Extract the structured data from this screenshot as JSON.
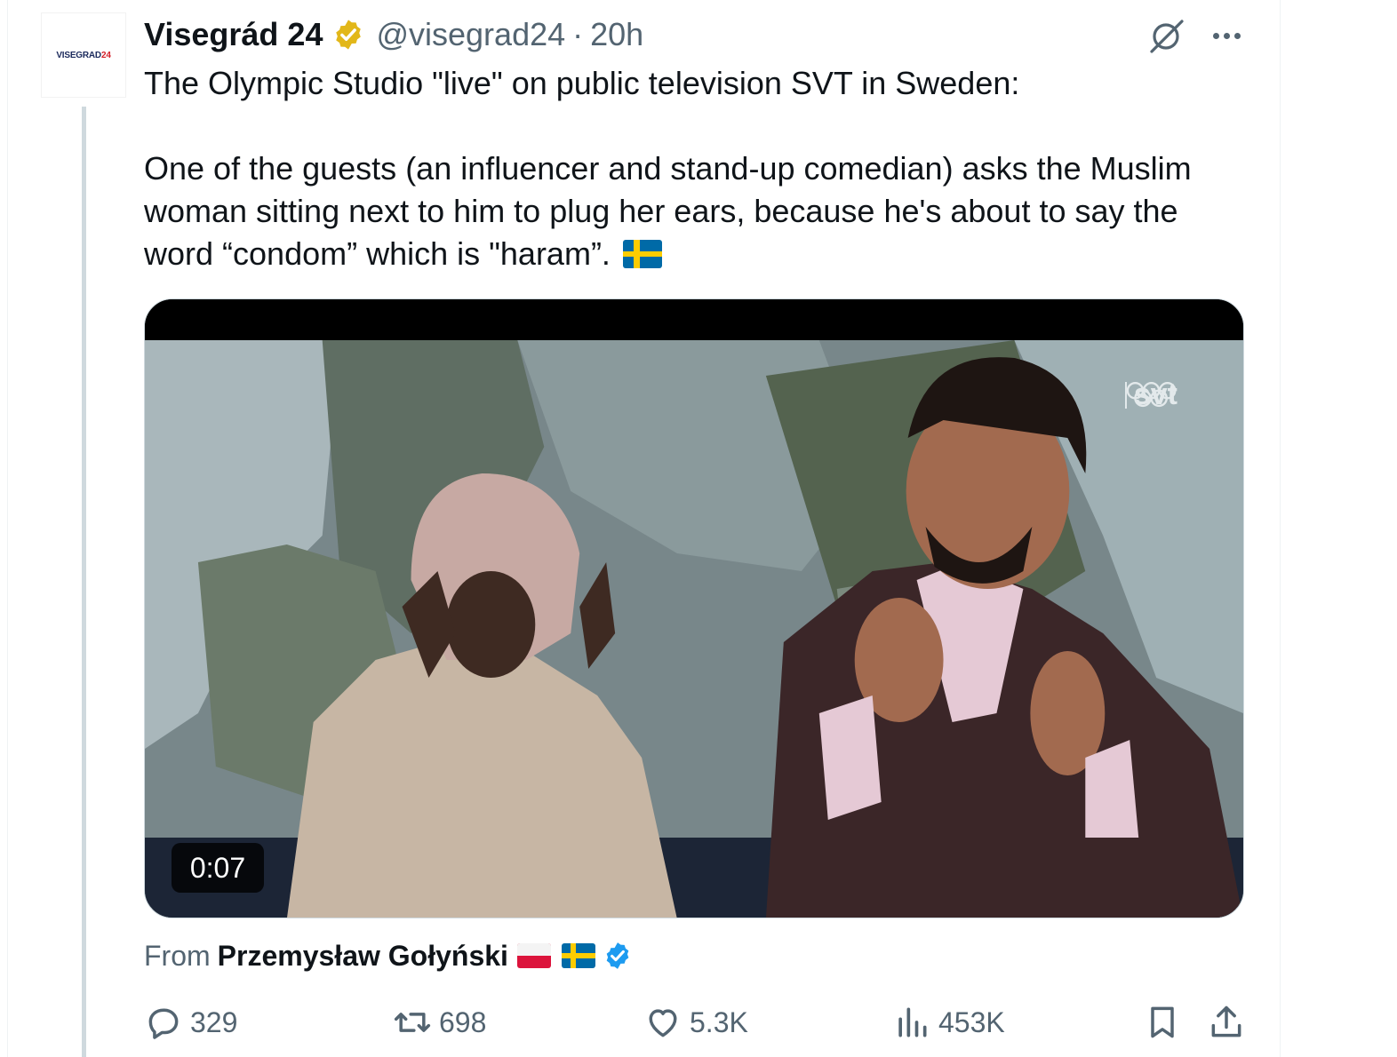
{
  "author": {
    "avatar_text_main": "VISEGRAD",
    "avatar_text_accent": "24",
    "name": "Visegrád 24",
    "handle": "@visegrad24",
    "separator": "·",
    "time": "20h"
  },
  "tweet": {
    "text": "The Olympic Studio \"live\" on public television SVT in Sweden:\n\nOne of the guests (an influencer and stand-up comedian) asks the Muslim woman sitting next to him to plug her ears, because he's about to say the word “condom” which is \"haram”."
  },
  "media": {
    "watermark": "svt",
    "duration": "0:07"
  },
  "attribution": {
    "prefix": "From",
    "name": "Przemysław Gołyński"
  },
  "actions": {
    "replies": "329",
    "reposts": "698",
    "likes": "5.3K",
    "views": "453K"
  },
  "icons": [
    "verified-gold-badge",
    "grok-icon",
    "more-icon",
    "reply-icon",
    "repost-icon",
    "like-icon",
    "views-icon",
    "bookmark-icon",
    "share-icon",
    "blue-verified-badge"
  ],
  "colors": {
    "text": "#0f1419",
    "secondary": "#536471",
    "gold": "#e2b719",
    "blue": "#1d9bf0"
  }
}
